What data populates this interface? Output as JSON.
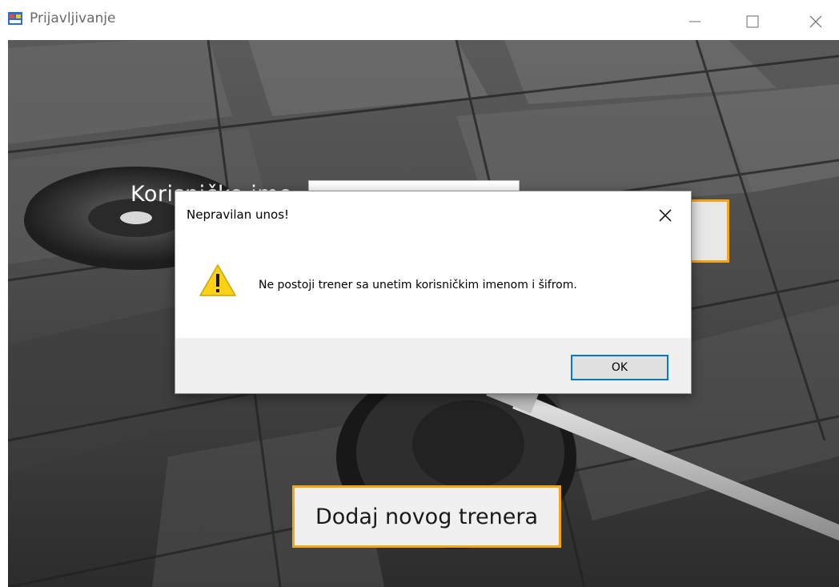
{
  "window": {
    "title": "Prijavljivanje",
    "app_icon": "windows-form-icon",
    "controls": [
      "minimize-icon",
      "maximize-icon",
      "close-icon"
    ]
  },
  "login": {
    "username_label": "Korisničko ime",
    "username_value": "",
    "login_button_label": ""
  },
  "add_trainer_button_label": "Dodaj novog trenera",
  "dialog": {
    "title": "Nepravilan unos!",
    "icon": "warning-icon",
    "message": "Ne postoji trener sa unetim korisničkim imenom i šifrom.",
    "ok_label": "OK",
    "accent_color": "#0078d7"
  },
  "colors": {
    "button_border": "#f2a516",
    "warning_yellow": "#fcd116"
  }
}
